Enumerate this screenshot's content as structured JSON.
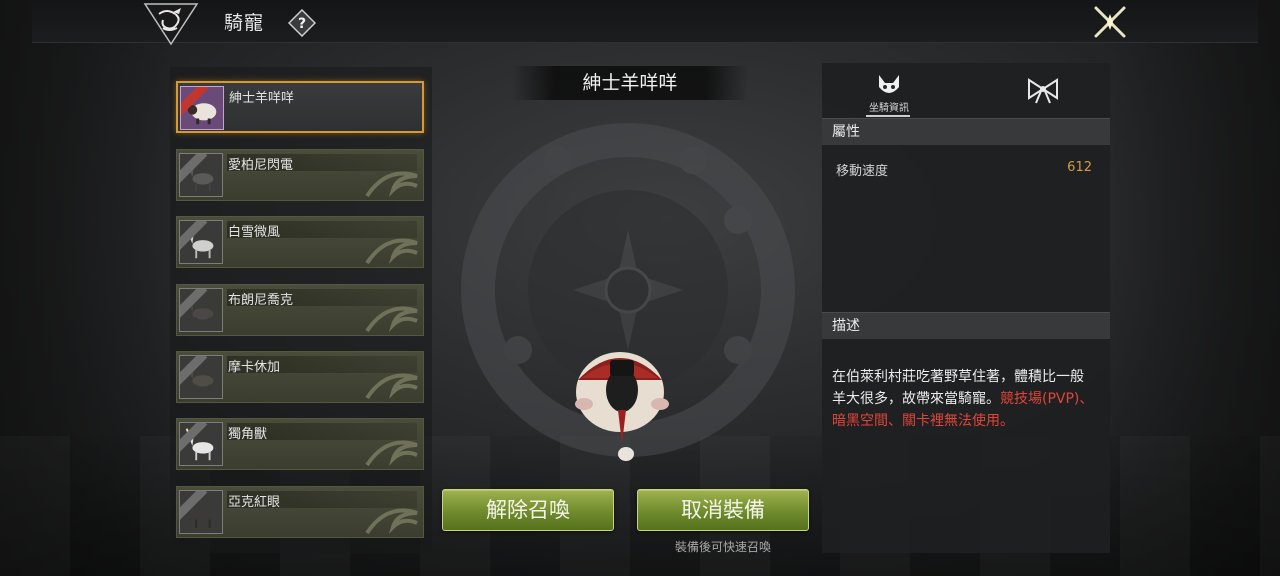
{
  "header": {
    "title": "騎寵",
    "help_icon": "question-mark-icon",
    "close_icon": "close-x-icon"
  },
  "mount_list": [
    {
      "name": "紳士羊咩咩",
      "selected": true,
      "icon": "sheep-icon"
    },
    {
      "name": "愛柏尼閃電",
      "selected": false,
      "icon": "horse-icon"
    },
    {
      "name": "白雪微風",
      "selected": false,
      "icon": "horse-icon"
    },
    {
      "name": "布朗尼喬克",
      "selected": false,
      "icon": "horse-icon"
    },
    {
      "name": "摩卡休加",
      "selected": false,
      "icon": "horse-icon"
    },
    {
      "name": "獨角獸",
      "selected": false,
      "icon": "unicorn-icon"
    },
    {
      "name": "亞克紅眼",
      "selected": false,
      "icon": "horse-icon"
    }
  ],
  "preview": {
    "mount_name": "紳士羊咩咩",
    "dismiss_label": "解除召喚",
    "unequip_label": "取消裝備",
    "hint": "裝備後可快速召喚"
  },
  "info": {
    "tabs": [
      {
        "label": "坐騎資訊",
        "icon": "mount-info-icon",
        "active": true
      },
      {
        "label": "",
        "icon": "bow-icon",
        "active": false
      }
    ],
    "attributes_heading": "屬性",
    "stats": [
      {
        "label": "移動速度",
        "value": "612"
      }
    ],
    "description_heading": "描述",
    "description_text": "在伯萊利村莊吃著野草住著，體積比一般羊大很多，故帶來當騎寵。",
    "description_warning": "競技場(PVP)、暗黑空間、關卡裡無法使用。"
  },
  "colors": {
    "accent_gold": "#d59a32",
    "button_green": "#6f8b2c",
    "stat_value": "#d29a4a",
    "warning_red": "#e2453a"
  }
}
